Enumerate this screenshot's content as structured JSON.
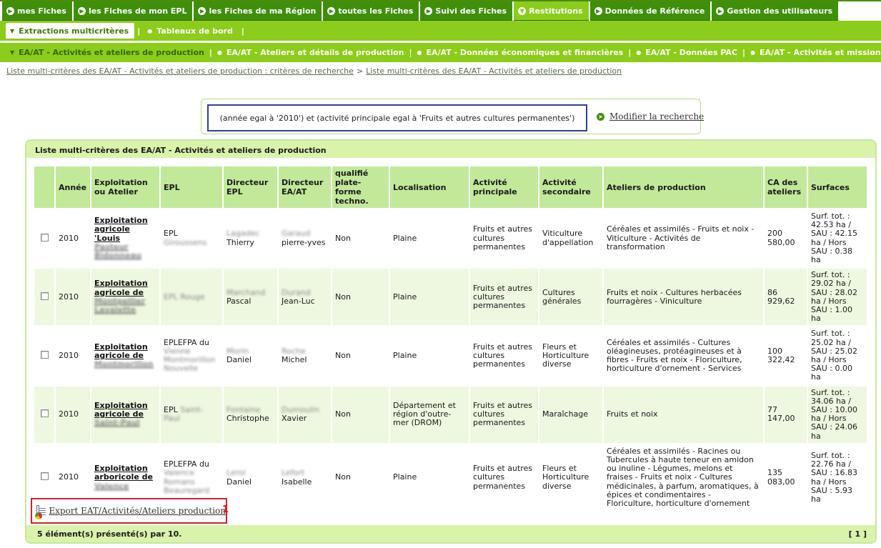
{
  "topnav": {
    "tabs": [
      {
        "label": "mes Fiches",
        "active": false
      },
      {
        "label": "les Fiches de mon EPL",
        "active": false
      },
      {
        "label": "les Fiches de ma Région",
        "active": false
      },
      {
        "label": "toutes les Fiches",
        "active": false
      },
      {
        "label": "Suivi des Fiches",
        "active": false
      },
      {
        "label": "Restitutions",
        "active": true
      },
      {
        "label": "Données de Référence",
        "active": false
      },
      {
        "label": "Gestion des utilisateurs",
        "active": false
      }
    ]
  },
  "subnav": {
    "items": [
      {
        "label": "Extractions multicritères",
        "selected": true
      },
      {
        "label": "Tableaux de bord",
        "selected": false
      }
    ]
  },
  "secnav": {
    "items": [
      {
        "label": "EA/AT - Activités et ateliers de production",
        "selected": true
      },
      {
        "label": "EA/AT - Ateliers et détails de production",
        "selected": false
      },
      {
        "label": "EA/AT - Données économiques et financières",
        "selected": false
      },
      {
        "label": "EA/AT - Données PAC",
        "selected": false
      },
      {
        "label": "EA/AT - Activités et missions",
        "selected": false
      }
    ]
  },
  "breadcrumb": {
    "first": "Liste multi-critères des EA/AT - Activités et ateliers de production : critères de recherche",
    "separator": ">",
    "second": "Liste multi-critères des EA/AT - Activités et ateliers de production"
  },
  "criteria": {
    "text": "(année egal à '2010') et (activité principale egal à 'Fruits et autres cultures permanentes')",
    "modify_label": "Modifier la recherche"
  },
  "results": {
    "title": "Liste multi-critères des EA/AT - Activités et ateliers de production",
    "columns": [
      "",
      "Année",
      "Exploitation ou Atelier",
      "EPL",
      "Directeur EPL",
      "Directeur EA/AT",
      "qualifié plate-forme techno.",
      "Localisation",
      "Activité principale",
      "Activité secondaire",
      "Ateliers de production",
      "CA des ateliers",
      "Surfaces"
    ],
    "rows": [
      {
        "annee": "2010",
        "exploitation": "Exploitation agricole 'Louis",
        "exploitation_hidden": "Pasteur Bidonneau",
        "epl": "EPL",
        "epl_hidden": "Giroussens",
        "dir_epl_hidden": "Lagadec",
        "dir_epl": "Thierry",
        "dir_ea_hidden": "Garaud",
        "dir_ea": "pierre-yves",
        "qualifie": "Non",
        "localisation": "Plaine",
        "activite_principale": "Fruits et autres cultures permanentes",
        "activite_secondaire": "Viticulture d'appellation",
        "ateliers": "Céréales et assimilés  - Fruits et noix  - Viticulture  - Activités de transformation",
        "ca": "200 580,00",
        "surfaces": "Surf. tot. : 42.53 ha / SAU : 42.15 ha / Hors SAU : 0.38 ha"
      },
      {
        "annee": "2010",
        "exploitation": "Exploitation agricole de",
        "exploitation_hidden": "Montpellier Lavalette",
        "epl": "",
        "epl_hidden": "EPL Rouge",
        "dir_epl_hidden": "Marchand",
        "dir_epl": "Pascal",
        "dir_ea_hidden": "Durand",
        "dir_ea": "Jean-Luc",
        "qualifie": "Non",
        "localisation": "Plaine",
        "activite_principale": "Fruits et autres cultures permanentes",
        "activite_secondaire": "Cultures générales",
        "ateliers": "Fruits et noix  - Cultures herbacées fourragères  - Viniculture",
        "ca": "86 929,62",
        "surfaces": "Surf. tot. : 29.02 ha / SAU : 28.02 ha / Hors SAU : 1.00 ha"
      },
      {
        "annee": "2010",
        "exploitation": "Exploitation agricole de",
        "exploitation_hidden": "Montmorillon",
        "epl": "EPLEFPA du",
        "epl_hidden": "Vienne Montmorillon Nouvelle",
        "dir_epl_hidden": "Morin",
        "dir_epl": "Daniel",
        "dir_ea_hidden": "Roche",
        "dir_ea": "Michel",
        "qualifie": "Non",
        "localisation": "Plaine",
        "activite_principale": "Fruits et autres cultures permanentes",
        "activite_secondaire": "Fleurs et Horticulture diverse",
        "ateliers": "Céréales et assimilés  - Cultures oléagineuses, protéagineuses et à fibres  - Fruits et noix  - Floriculture, horticulture d'ornement  - Services",
        "ca": "100 322,42",
        "surfaces": "Surf. tot. : 25.02 ha / SAU : 25.02 ha / Hors SAU : 0.00 ha"
      },
      {
        "annee": "2010",
        "exploitation": "Exploitation agricole de",
        "exploitation_hidden": "Saint-Paul",
        "epl": "EPL",
        "epl_hidden": "Saint-Paul",
        "dir_epl_hidden": "Fontaine",
        "dir_epl": "Christophe",
        "dir_ea_hidden": "Dumoulin",
        "dir_ea": "Xavier",
        "qualifie": "Non",
        "localisation": "Département et région d'outre-mer (DROM)",
        "activite_principale": "Fruits et autres cultures permanentes",
        "activite_secondaire": "Maraîchage",
        "ateliers": "Fruits et noix",
        "ca": "77 147,00",
        "surfaces": "Surf. tot. : 34.06 ha / SAU : 10.00 ha / Hors SAU : 24.06 ha"
      },
      {
        "annee": "2010",
        "exploitation": "Exploitation arboricole de",
        "exploitation_hidden": "Valence",
        "epl": "EPLEFPA du",
        "epl_hidden": "Valence Romans Beauregard",
        "dir_epl_hidden": "Leroi",
        "dir_epl": "Daniel",
        "dir_ea_hidden": "Lefort",
        "dir_ea": "Isabelle",
        "qualifie": "Non",
        "localisation": "Plaine",
        "activite_principale": "Fruits et autres cultures permanentes",
        "activite_secondaire": "Fleurs et Horticulture diverse",
        "ateliers": "Céréales et assimilés  - Racines ou Tubercules à haute teneur en amidon ou inuline  - Légumes, melons et fraises  - Fruits et noix  - Cultures médicinales, à parfum, aromatiques, à épices et condimentaires  - Floriculture, horticulture d'ornement",
        "ca": "135 083,00",
        "surfaces": "Surf. tot. : 22.76 ha / SAU : 16.83 ha / Hors SAU : 5.93 ha"
      }
    ]
  },
  "export": {
    "label": "Export EAT/Activités/Ateliers production",
    "marker": "1"
  },
  "footer": {
    "count_text": "5 élément(s) présenté(s) par 10.",
    "pager": "[ 1 ]"
  }
}
